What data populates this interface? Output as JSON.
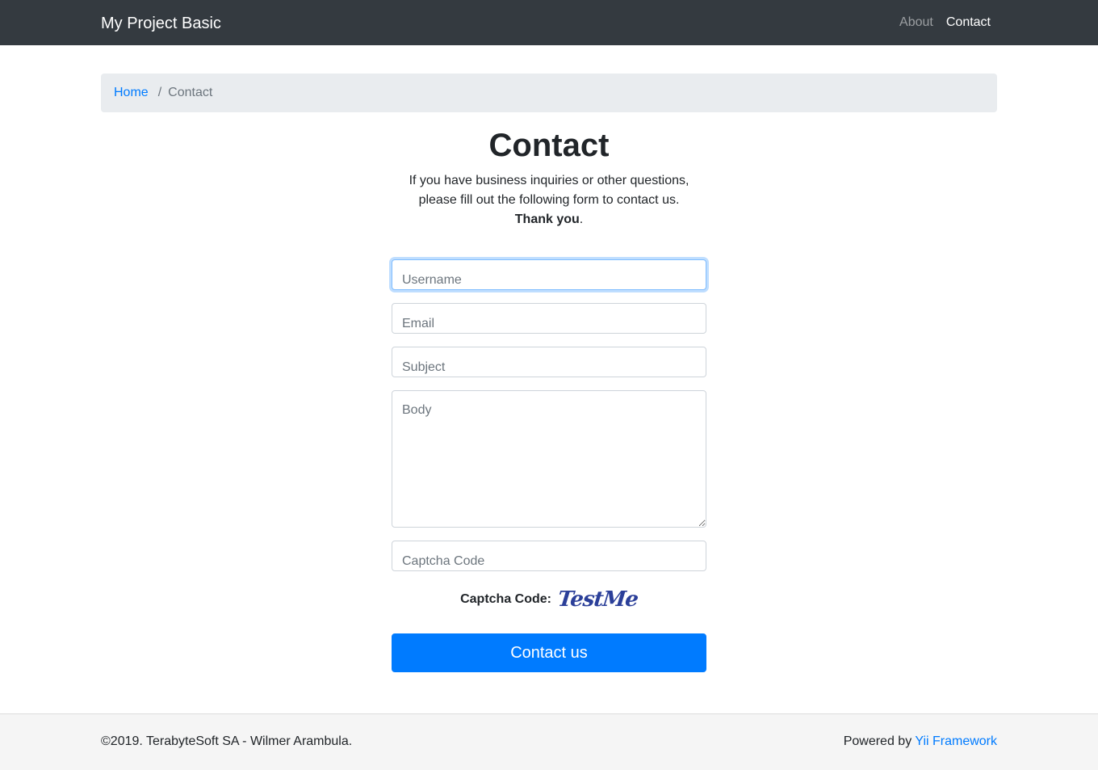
{
  "navbar": {
    "brand": "My Project Basic",
    "links": [
      {
        "label": "About",
        "active": false
      },
      {
        "label": "Contact",
        "active": true
      }
    ]
  },
  "breadcrumb": {
    "home": "Home",
    "separator": "/",
    "current": "Contact"
  },
  "page": {
    "title": "Contact",
    "intro_line1": "If you have business inquiries or other questions,",
    "intro_line2": "please fill out the following form to contact us.",
    "thank_you": "Thank you",
    "thank_suffix": "."
  },
  "form": {
    "username_placeholder": "Username",
    "email_placeholder": "Email",
    "subject_placeholder": "Subject",
    "body_placeholder": "Body",
    "captcha_placeholder": "Captcha Code",
    "captcha_label": "Captcha Code:",
    "captcha_image_text": "TestMe",
    "submit_label": "Contact us"
  },
  "footer": {
    "copyright": "©2019. TerabyteSoft SA - Wilmer Arambula.",
    "powered_prefix": "Powered by ",
    "powered_link": "Yii Framework"
  },
  "colors": {
    "navbar_bg": "#343a40",
    "primary": "#007bff",
    "breadcrumb_bg": "#e9ecef",
    "footer_bg": "#f5f5f5"
  }
}
